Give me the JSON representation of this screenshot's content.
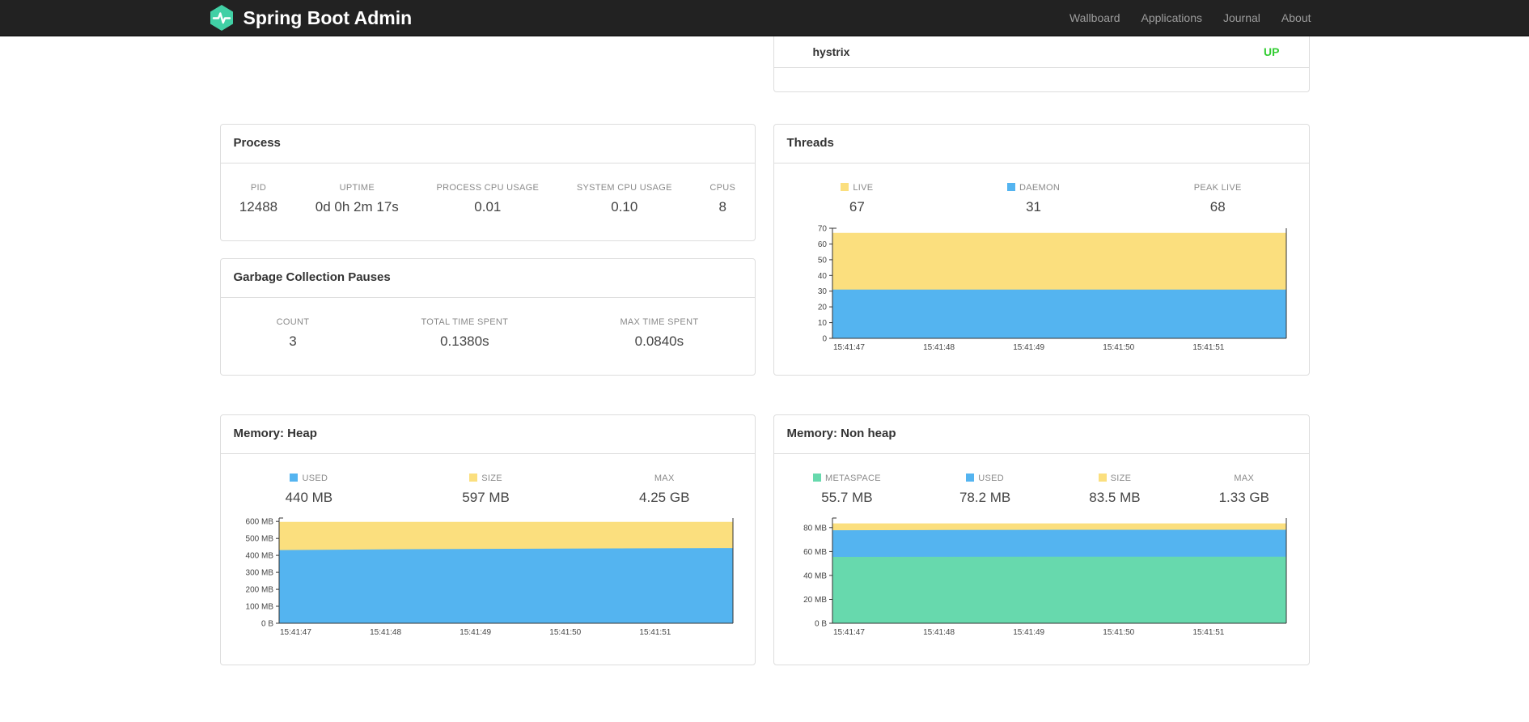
{
  "navbar": {
    "brand": "Spring Boot Admin",
    "links": [
      {
        "label": "Wallboard"
      },
      {
        "label": "Applications"
      },
      {
        "label": "Journal"
      },
      {
        "label": "About"
      }
    ],
    "logo_color": "#41D0A5"
  },
  "health": {
    "row": {
      "name": "hystrix",
      "status": "UP",
      "status_color": "#32CD32"
    }
  },
  "panels": {
    "process": {
      "title": "Process",
      "metrics": [
        {
          "label": "PID",
          "value": "12488"
        },
        {
          "label": "UPTIME",
          "value": "0d 0h 2m 17s"
        },
        {
          "label": "PROCESS CPU USAGE",
          "value": "0.01"
        },
        {
          "label": "SYSTEM CPU USAGE",
          "value": "0.10"
        },
        {
          "label": "CPUS",
          "value": "8"
        }
      ]
    },
    "gc": {
      "title": "Garbage Collection Pauses",
      "metrics": [
        {
          "label": "COUNT",
          "value": "3"
        },
        {
          "label": "TOTAL TIME SPENT",
          "value": "0.1380s"
        },
        {
          "label": "MAX TIME SPENT",
          "value": "0.0840s"
        }
      ]
    },
    "threads": {
      "title": "Threads",
      "legend": [
        {
          "label": "LIVE",
          "value": "67",
          "color": "#FBDF7E"
        },
        {
          "label": "DAEMON",
          "value": "31",
          "color": "#54B4F0"
        },
        {
          "label": "PEAK LIVE",
          "value": "68"
        }
      ]
    },
    "heap": {
      "title": "Memory: Heap",
      "legend": [
        {
          "label": "USED",
          "value": "440 MB",
          "color": "#54B4F0"
        },
        {
          "label": "SIZE",
          "value": "597 MB",
          "color": "#FBDF7E"
        },
        {
          "label": "MAX",
          "value": "4.25 GB"
        }
      ]
    },
    "nonheap": {
      "title": "Memory: Non heap",
      "legend": [
        {
          "label": "METASPACE",
          "value": "55.7 MB",
          "color": "#67D9AD"
        },
        {
          "label": "USED",
          "value": "78.2 MB",
          "color": "#54B4F0"
        },
        {
          "label": "SIZE",
          "value": "83.5 MB",
          "color": "#FBDF7E"
        },
        {
          "label": "MAX",
          "value": "1.33 GB"
        }
      ]
    }
  },
  "chart_data": [
    {
      "type": "area",
      "title": "Threads",
      "x": [
        "15:41:47",
        "15:41:48",
        "15:41:49",
        "15:41:50",
        "15:41:51"
      ],
      "series": [
        {
          "name": "DAEMON",
          "color": "#54B4F0",
          "values": [
            31,
            31,
            31,
            31,
            31
          ]
        },
        {
          "name": "LIVE",
          "color": "#FBDF7E",
          "values": [
            67,
            67,
            67,
            67,
            67
          ]
        }
      ],
      "stacked": "absolute-tops",
      "ylim": [
        0,
        70
      ],
      "yticks": [
        {
          "v": 0,
          "label": "0"
        },
        {
          "v": 10,
          "label": "10"
        },
        {
          "v": 20,
          "label": "20"
        },
        {
          "v": 30,
          "label": "30"
        },
        {
          "v": 40,
          "label": "40"
        },
        {
          "v": 50,
          "label": "50"
        },
        {
          "v": 60,
          "label": "60"
        },
        {
          "v": 70,
          "label": "70"
        }
      ]
    },
    {
      "type": "area",
      "title": "Memory: Heap (MB)",
      "x": [
        "15:41:47",
        "15:41:48",
        "15:41:49",
        "15:41:50",
        "15:41:51"
      ],
      "series": [
        {
          "name": "USED",
          "color": "#54B4F0",
          "values": [
            431,
            436,
            439,
            441,
            443
          ]
        },
        {
          "name": "SIZE",
          "color": "#FBDF7E",
          "values": [
            597,
            597,
            597,
            597,
            597
          ]
        }
      ],
      "stacked": "absolute-tops",
      "ylim": [
        0,
        620
      ],
      "yticks": [
        {
          "v": 0,
          "label": "0 B"
        },
        {
          "v": 100,
          "label": "100 MB"
        },
        {
          "v": 200,
          "label": "200 MB"
        },
        {
          "v": 300,
          "label": "300 MB"
        },
        {
          "v": 400,
          "label": "400 MB"
        },
        {
          "v": 500,
          "label": "500 MB"
        },
        {
          "v": 600,
          "label": "600 MB"
        }
      ]
    },
    {
      "type": "area",
      "title": "Memory: Non heap (MB)",
      "x": [
        "15:41:47",
        "15:41:48",
        "15:41:49",
        "15:41:50",
        "15:41:51"
      ],
      "series": [
        {
          "name": "METASPACE",
          "color": "#67D9AD",
          "values": [
            55.5,
            55.6,
            55.7,
            55.7,
            55.7
          ]
        },
        {
          "name": "USED",
          "color": "#54B4F0",
          "values": [
            77.8,
            78.0,
            78.2,
            78.2,
            78.2
          ]
        },
        {
          "name": "SIZE",
          "color": "#FBDF7E",
          "values": [
            83.5,
            83.5,
            83.5,
            83.5,
            83.5
          ]
        }
      ],
      "stacked": "absolute-tops",
      "ylim": [
        0,
        88
      ],
      "yticks": [
        {
          "v": 0,
          "label": "0 B"
        },
        {
          "v": 20,
          "label": "20 MB"
        },
        {
          "v": 40,
          "label": "40 MB"
        },
        {
          "v": 60,
          "label": "60 MB"
        },
        {
          "v": 80,
          "label": "80 MB"
        }
      ]
    }
  ]
}
